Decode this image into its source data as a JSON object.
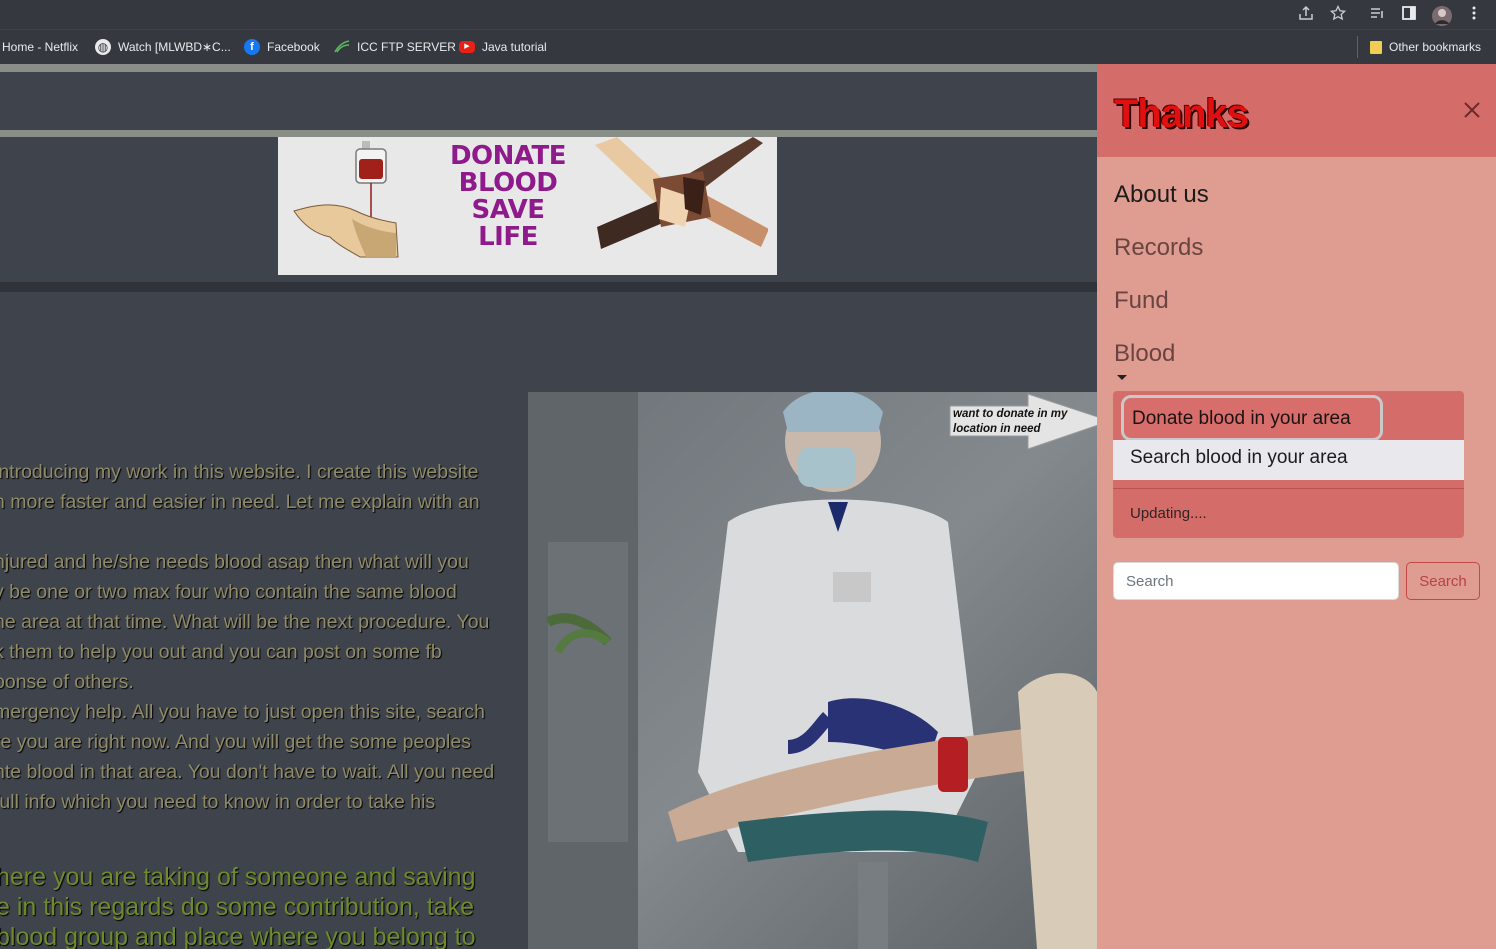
{
  "browser": {
    "bookmarks": [
      {
        "label": "Home - Netflix"
      },
      {
        "label": "Watch [MLWBD∗C..."
      },
      {
        "label": "Facebook"
      },
      {
        "label": "ICC FTP SERVER"
      },
      {
        "label": "Java tutorial"
      }
    ],
    "other_bookmarks": "Other bookmarks"
  },
  "banner": {
    "lines": [
      "DONATE",
      "BLOOD",
      "SAVE",
      "LIFE"
    ]
  },
  "article": {
    "lines": [
      " introducing my work in this website. I create this website",
      "n more faster and easier in need. Let me explain with an",
      "",
      "njured and he/she needs blood asap then what will you",
      "y be one or two max four who contain the same blood",
      "he area at that time. What will be the next procedure. You",
      "k them to help you out and you can post on some fb",
      "ponse of others.",
      "mergency help. All you have to just open this site, search",
      "re you are right now. And you will get the some peoples",
      "nte blood in that area. You don't have to wait. All you need",
      " full info which you need to know in order to take his"
    ],
    "highlight_lines": [
      "here you are taking of someone and saving",
      "e in this regards do some contribution, take",
      " blood group and place where you belong to"
    ]
  },
  "callout": {
    "text": "want to donate in my location in need"
  },
  "sidebar": {
    "title": "Thanks",
    "links": [
      "About us",
      "Records",
      "Fund",
      "Blood"
    ],
    "dropdown": {
      "items": [
        "Donate blood in your area",
        "Search blood in your area",
        "Updating...."
      ]
    },
    "search": {
      "placeholder": "Search",
      "button": "Search"
    }
  }
}
